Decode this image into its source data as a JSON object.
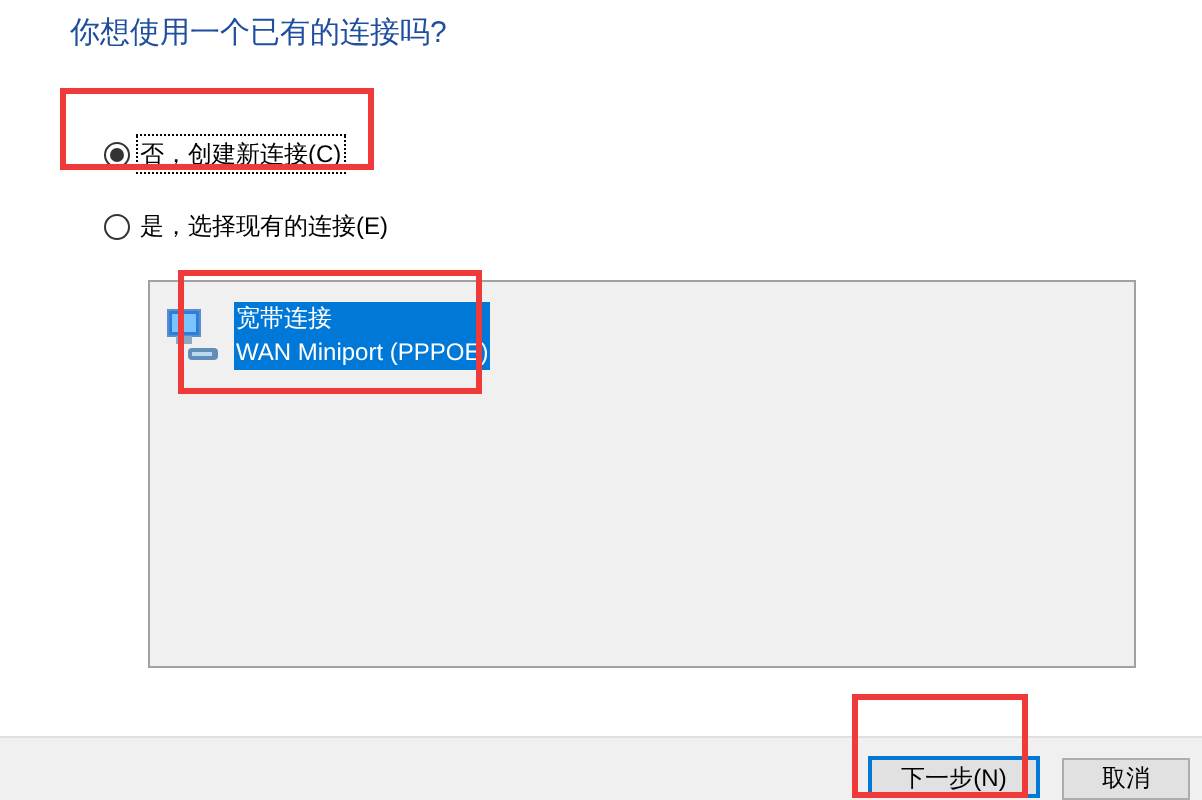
{
  "heading": "你想使用一个已有的连接吗?",
  "options": [
    {
      "label": "否，创建新连接(C)",
      "selected": true,
      "focused": true,
      "highlighted": true
    },
    {
      "label": "是，选择现有的连接(E)",
      "selected": false,
      "focused": false,
      "highlighted": false
    }
  ],
  "connections": [
    {
      "name": "宽带连接",
      "device": "WAN Miniport (PPPOE)",
      "selected": true,
      "highlighted": true
    }
  ],
  "buttons": [
    {
      "label": "下一步(N)",
      "default": true,
      "highlighted": true
    },
    {
      "label": "取消",
      "default": false,
      "highlighted": false
    }
  ]
}
